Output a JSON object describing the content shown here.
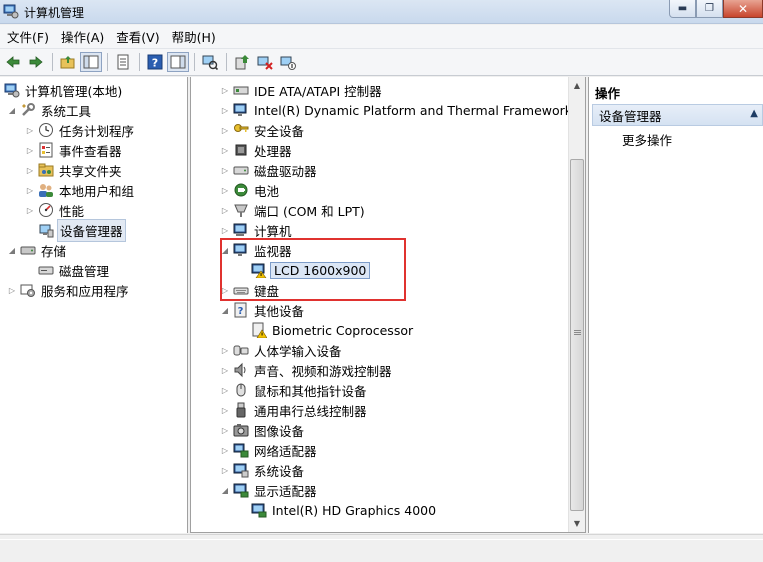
{
  "window": {
    "title": "计算机管理",
    "buttons": {
      "minimize": "▬",
      "maximize": "❐",
      "close": "✕"
    }
  },
  "menubar": [
    {
      "label": "文件(F)"
    },
    {
      "label": "操作(A)"
    },
    {
      "label": "查看(V)"
    },
    {
      "label": "帮助(H)"
    }
  ],
  "left_tree": [
    {
      "label": "计算机管理(本地)",
      "icon": "computer-management-icon"
    },
    {
      "label": "系统工具",
      "icon": "tools-icon"
    },
    {
      "label": "任务计划程序",
      "icon": "clock-icon"
    },
    {
      "label": "事件查看器",
      "icon": "event-viewer-icon"
    },
    {
      "label": "共享文件夹",
      "icon": "shared-folder-icon"
    },
    {
      "label": "本地用户和组",
      "icon": "users-icon"
    },
    {
      "label": "性能",
      "icon": "performance-icon"
    },
    {
      "label": "设备管理器",
      "icon": "device-manager-icon"
    },
    {
      "label": "存储",
      "icon": "storage-icon"
    },
    {
      "label": "磁盘管理",
      "icon": "disk-management-icon"
    },
    {
      "label": "服务和应用程序",
      "icon": "services-icon"
    }
  ],
  "device_tree": [
    {
      "label": "IDE ATA/ATAPI 控制器",
      "icon": "ide-controller-icon"
    },
    {
      "label": "Intel(R) Dynamic Platform and Thermal Framework",
      "icon": "monitor-device-icon"
    },
    {
      "label": "安全设备",
      "icon": "key-icon"
    },
    {
      "label": "处理器",
      "icon": "processor-icon"
    },
    {
      "label": "磁盘驱动器",
      "icon": "disk-drive-icon"
    },
    {
      "label": "电池",
      "icon": "battery-icon"
    },
    {
      "label": "端口 (COM 和 LPT)",
      "icon": "port-icon"
    },
    {
      "label": "计算机",
      "icon": "computer-icon"
    },
    {
      "label": "监视器",
      "icon": "monitor-icon"
    },
    {
      "label": "LCD 1600x900",
      "icon": "monitor-warning-icon"
    },
    {
      "label": "键盘",
      "icon": "keyboard-icon"
    },
    {
      "label": "其他设备",
      "icon": "unknown-device-icon"
    },
    {
      "label": "Biometric Coprocessor",
      "icon": "unknown-device-warning-icon"
    },
    {
      "label": "人体学输入设备",
      "icon": "hid-icon"
    },
    {
      "label": "声音、视频和游戏控制器",
      "icon": "speaker-icon"
    },
    {
      "label": "鼠标和其他指针设备",
      "icon": "mouse-icon"
    },
    {
      "label": "通用串行总线控制器",
      "icon": "usb-icon"
    },
    {
      "label": "图像设备",
      "icon": "camera-icon"
    },
    {
      "label": "网络适配器",
      "icon": "network-adapter-icon"
    },
    {
      "label": "系统设备",
      "icon": "system-device-icon"
    },
    {
      "label": "显示适配器",
      "icon": "display-adapter-icon"
    },
    {
      "label": "Intel(R) HD Graphics 4000",
      "icon": "display-adapter-icon"
    }
  ],
  "actions": {
    "header": "操作",
    "section": "设备管理器",
    "more": "更多操作"
  }
}
